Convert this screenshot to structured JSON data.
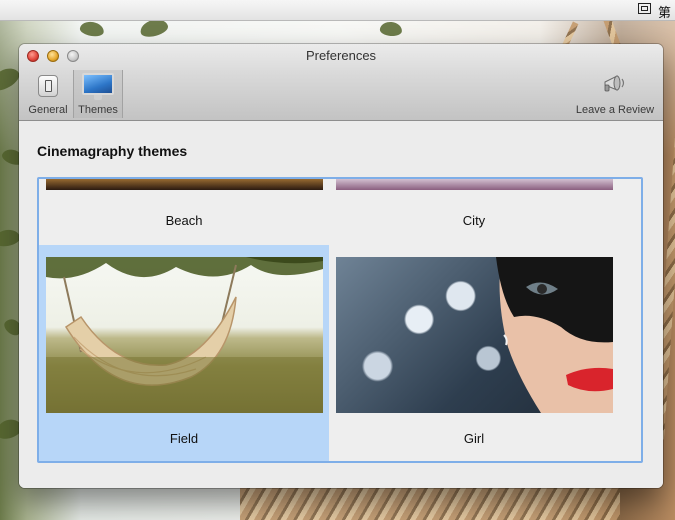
{
  "menubar": {
    "right_char": "第"
  },
  "window": {
    "title": "Preferences"
  },
  "toolbar": {
    "general_label": "General",
    "themes_label": "Themes",
    "review_label": "Leave a Review"
  },
  "content": {
    "section_title": "Cinemagraphy themes",
    "themes": [
      {
        "label": "Beach",
        "selected": false
      },
      {
        "label": "City",
        "selected": false
      },
      {
        "label": "Field",
        "selected": true
      },
      {
        "label": "Girl",
        "selected": false
      }
    ]
  },
  "colors": {
    "selection": "#b7d6f8",
    "focus_ring": "#7eaee8",
    "lipstick": "#d9242c"
  }
}
